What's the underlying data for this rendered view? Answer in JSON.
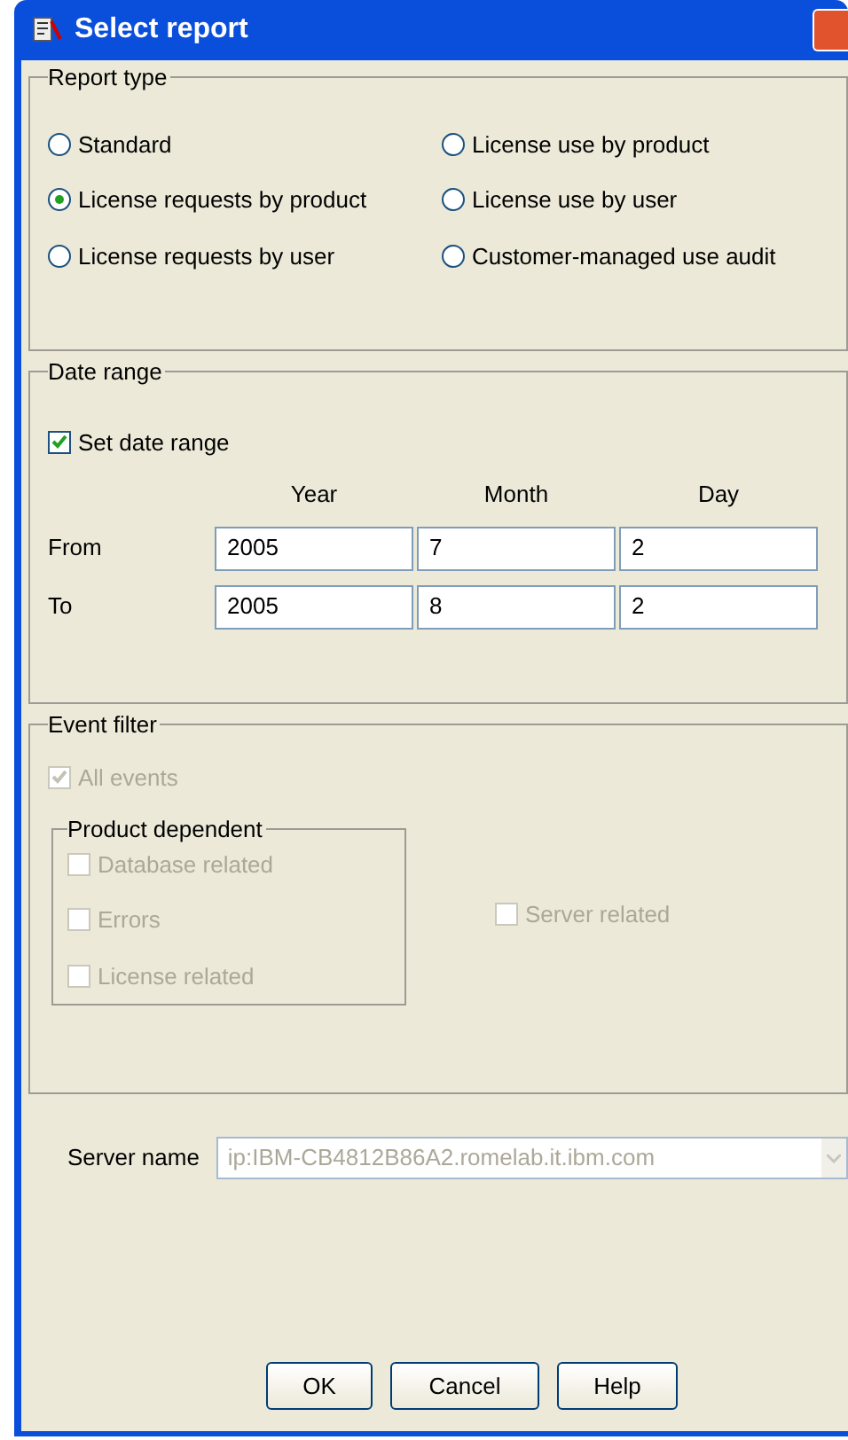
{
  "window": {
    "title": "Select report"
  },
  "report_type": {
    "legend": "Report type",
    "options": [
      {
        "label": "Standard",
        "selected": false
      },
      {
        "label": "License use by product",
        "selected": false
      },
      {
        "label": "License requests by product",
        "selected": true
      },
      {
        "label": "License use by user",
        "selected": false
      },
      {
        "label": "License requests by user",
        "selected": false
      },
      {
        "label": "Customer-managed use audit",
        "selected": false
      }
    ]
  },
  "date_range": {
    "legend": "Date range",
    "set_date_range": {
      "label": "Set date range",
      "checked": true
    },
    "columns": [
      "Year",
      "Month",
      "Day"
    ],
    "rows": [
      {
        "label": "From",
        "values": [
          "2005",
          "7",
          "2"
        ]
      },
      {
        "label": "To",
        "values": [
          "2005",
          "8",
          "2"
        ]
      }
    ]
  },
  "event_filter": {
    "legend": "Event filter",
    "all_events": {
      "label": "All events",
      "checked": true,
      "disabled": true
    },
    "product_dependent": {
      "legend": "Product dependent",
      "items": [
        {
          "label": "Database related",
          "checked": false,
          "disabled": true
        },
        {
          "label": "Errors",
          "checked": false,
          "disabled": true
        },
        {
          "label": "License related",
          "checked": false,
          "disabled": true
        }
      ]
    },
    "server_related": {
      "label": "Server related",
      "checked": false,
      "disabled": true
    }
  },
  "server_name": {
    "label": "Server name",
    "value": "ip:IBM-CB4812B86A2.romelab.it.ibm.com",
    "disabled": true
  },
  "buttons": [
    "OK",
    "Cancel",
    "Help"
  ]
}
